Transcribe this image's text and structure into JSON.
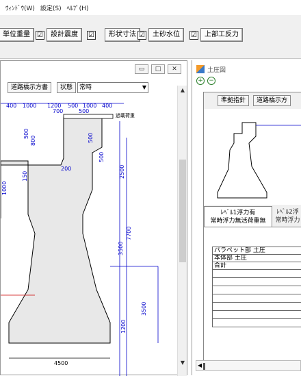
{
  "menu": [
    "ｳｨﾝﾄﾞｳ(W)",
    "設定(S)",
    "ﾍﾙﾌﾟ(H)"
  ],
  "toolbar": {
    "buttons": [
      {
        "label": "単位重量",
        "checked": "☑"
      },
      {
        "label": "設計震度",
        "checked": "☑"
      },
      {
        "label": "形状寸法",
        "checked": "☑"
      },
      {
        "label": "土砂水位",
        "checked": "☑"
      },
      {
        "label": "上部工反力",
        "checked": "☑"
      }
    ]
  },
  "main_window": {
    "controls": {
      "minimize": "▭",
      "maximize": "□",
      "close": "✕"
    },
    "sub_toolbar": {
      "spec_button": "道路橋示方書",
      "state_label": "状態",
      "state_value": "常時"
    },
    "drawing": {
      "top_dims": [
        "400",
        "1000",
        "1200",
        "500",
        "1000",
        "400"
      ],
      "sub_dims": [
        "700",
        "500"
      ],
      "mid_dims": [
        "500",
        "800",
        "200",
        "500",
        "500",
        "150",
        "1000",
        "2500"
      ],
      "load_label": "過載荷重",
      "right_dims": [
        "7700",
        "3500",
        "1200",
        "3500"
      ],
      "bottom_dim": "4500"
    }
  },
  "earth_pressure_window": {
    "title": "土圧図",
    "zoom_in": "+",
    "zoom_out": "−",
    "buttons": [
      "準拠指針",
      "道路橋示方"
    ],
    "tabs": [
      {
        "line1": "ﾚﾍﾞﾙ1浮力有",
        "line2": "常時浮力無活荷重無"
      },
      {
        "line1": "ﾚﾍﾞﾙ2浮",
        "line2": "常時浮力"
      }
    ],
    "table_rows": [
      "パラペット部 土圧",
      "本体部 土圧",
      "合計"
    ]
  },
  "colors": {
    "drawing_blue": "#0000cc",
    "body_fill": "#e8e8e8",
    "red": "#cc0000"
  }
}
